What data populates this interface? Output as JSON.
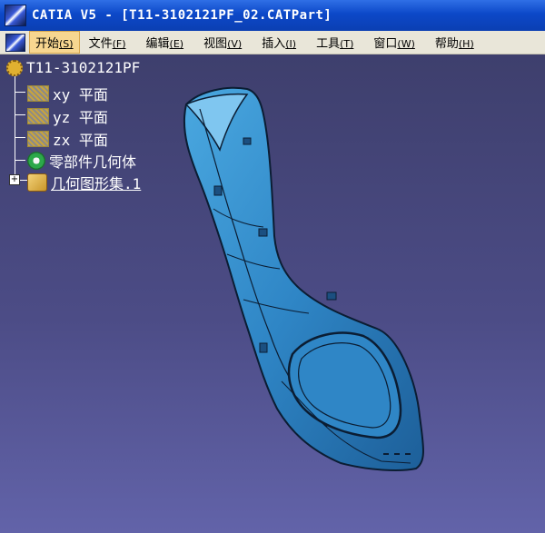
{
  "window": {
    "title": "CATIA V5 - [T11-3102121PF_02.CATPart]"
  },
  "menu": {
    "items": [
      {
        "label": "开始",
        "accel": "(S)",
        "active": true
      },
      {
        "label": "文件",
        "accel": "(F)"
      },
      {
        "label": "编辑",
        "accel": "(E)"
      },
      {
        "label": "视图",
        "accel": "(V)"
      },
      {
        "label": "插入",
        "accel": "(I)"
      },
      {
        "label": "工具",
        "accel": "(T)"
      },
      {
        "label": "窗口",
        "accel": "(W)"
      },
      {
        "label": "帮助",
        "accel": "(H)"
      }
    ]
  },
  "tree": {
    "root": "T11-3102121PF",
    "xy": "xy 平面",
    "yz": "yz 平面",
    "zx": "zx 平面",
    "body": "零部件几何体",
    "geoset": "几何图形集.1"
  },
  "icons": {
    "app": "catia-logo-icon",
    "plane": "plane-icon",
    "body": "part-body-icon",
    "geoset": "geometrical-set-icon"
  },
  "colors": {
    "titlebar": "#0c48c8",
    "viewport_top": "#3e3f6d",
    "viewport_bottom": "#6263a9",
    "part": "#2f86c6"
  }
}
